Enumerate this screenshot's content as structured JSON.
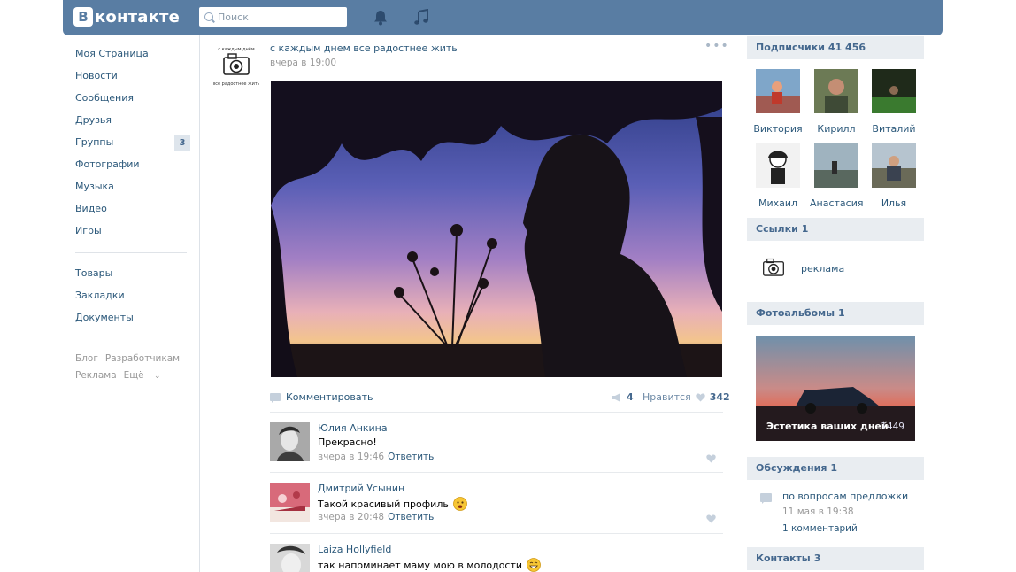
{
  "header": {
    "logo_letter": "В",
    "logo_text": "контакте",
    "search_placeholder": "Поиск"
  },
  "left_menu": {
    "items": [
      {
        "label": "Моя Страница"
      },
      {
        "label": "Новости"
      },
      {
        "label": "Сообщения"
      },
      {
        "label": "Друзья"
      },
      {
        "label": "Группы",
        "badge": "3"
      },
      {
        "label": "Фотографии"
      },
      {
        "label": "Музыка"
      },
      {
        "label": "Видео"
      },
      {
        "label": "Игры"
      }
    ],
    "items2": [
      {
        "label": "Товары"
      },
      {
        "label": "Закладки"
      },
      {
        "label": "Документы"
      }
    ],
    "footer": {
      "blog": "Блог",
      "developers": "Разработчикам",
      "ads": "Реклама",
      "more": "Ещё"
    }
  },
  "post": {
    "text": "с каждым днем все радостнее жить",
    "time": "вчера в 19:00",
    "comment_label": "Комментировать",
    "share_count": "4",
    "like_label": "Нравится",
    "like_count": "342"
  },
  "comments": [
    {
      "name": "Юлия Анкина",
      "text": "Прекрасно!",
      "time": "вчера в 19:46",
      "reply": "Ответить"
    },
    {
      "name": "Дмитрий Усынин",
      "text": "Такой красивый профиль",
      "time": "вчера в 20:48",
      "reply": "Ответить"
    },
    {
      "name": "Laiza Hollyfield",
      "text": "так напоминает маму мою в молодости"
    }
  ],
  "right": {
    "subscribers_title": "Подписчики",
    "subscribers_count": "41 456",
    "subscribers": [
      {
        "name": "Виктория"
      },
      {
        "name": "Кирилл"
      },
      {
        "name": "Виталий"
      },
      {
        "name": "Михаил"
      },
      {
        "name": "Анастасия"
      },
      {
        "name": "Илья"
      }
    ],
    "links_title": "Ссылки",
    "links_count": "1",
    "link_label": "реклама",
    "albums_title": "Фотоальбомы",
    "albums_count": "1",
    "album_name": "Эстетика ваших дней",
    "album_count": "1449",
    "discussions_title": "Обсуждения",
    "discussions_count": "1",
    "discussion_title": "по вопросам предложки",
    "discussion_date": "11 мая в 19:38",
    "discussion_comments": "1 комментарий",
    "contacts_title": "Контакты",
    "contacts_count": "3"
  },
  "colors": {
    "header": "#597da3",
    "link": "#2b587a",
    "block_head": "#e9edf1"
  }
}
